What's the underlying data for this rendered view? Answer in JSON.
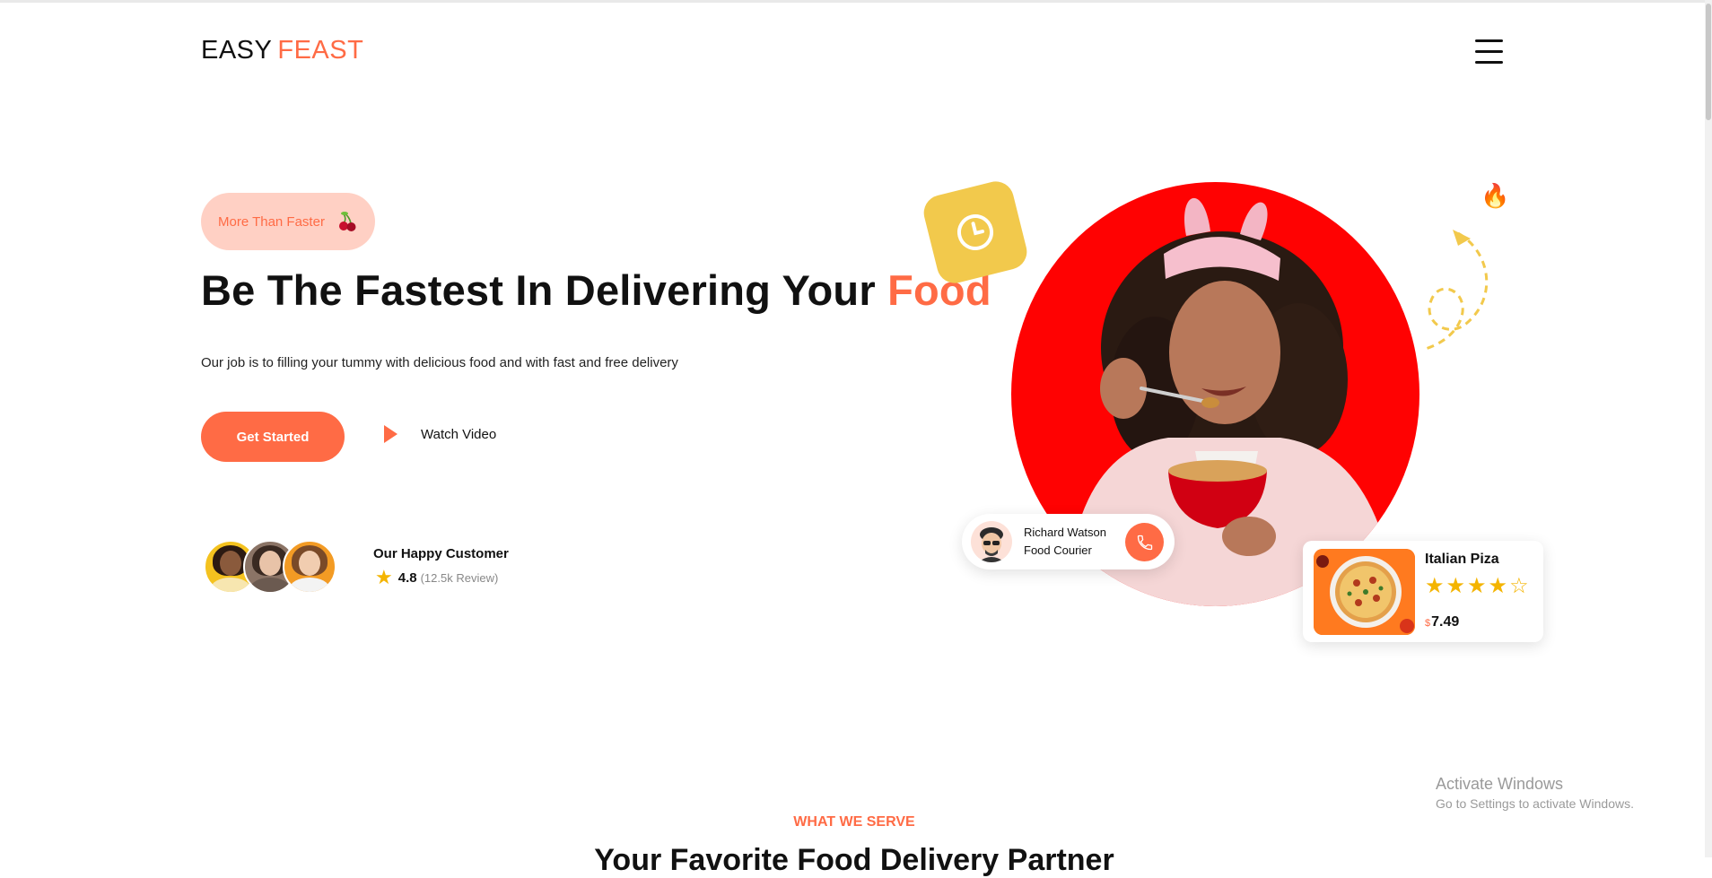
{
  "header": {
    "logo_primary": "EASY",
    "logo_accent": "FEAST",
    "menu_icon": "hamburger-menu-icon"
  },
  "hero": {
    "badge_text": "More Than Faster",
    "badge_icon": "cherry-icon",
    "headline_main": "Be The Fastest In Delivering Your",
    "headline_accent": "Food",
    "subtext": "Our job is to filling your tummy with delicious food and with fast and free delivery",
    "primary_button": "Get Started",
    "video_button": "Watch Video"
  },
  "customers": {
    "title": "Our Happy Customer",
    "rating": "4.8",
    "reviews": "(12.5k Review)"
  },
  "courier": {
    "name": "Richard Watson",
    "role": "Food Courier"
  },
  "product": {
    "name": "Italian Piza",
    "stars": "★★★★",
    "empty_star": "☆",
    "rating_value": 4,
    "rating_max": 5,
    "currency": "$",
    "price": "7.49"
  },
  "section": {
    "label": "WHAT WE SERVE",
    "title": "Your Favorite Food Delivery Partner"
  },
  "os_watermark": {
    "title": "Activate Windows",
    "subtitle": "Go to Settings to activate Windows."
  },
  "colors": {
    "accent": "#ff6b45",
    "hero_circle": "#ff0202",
    "clock_tile": "#f2c94c",
    "badge_bg": "#ffd0c4",
    "star": "#f4b400"
  }
}
